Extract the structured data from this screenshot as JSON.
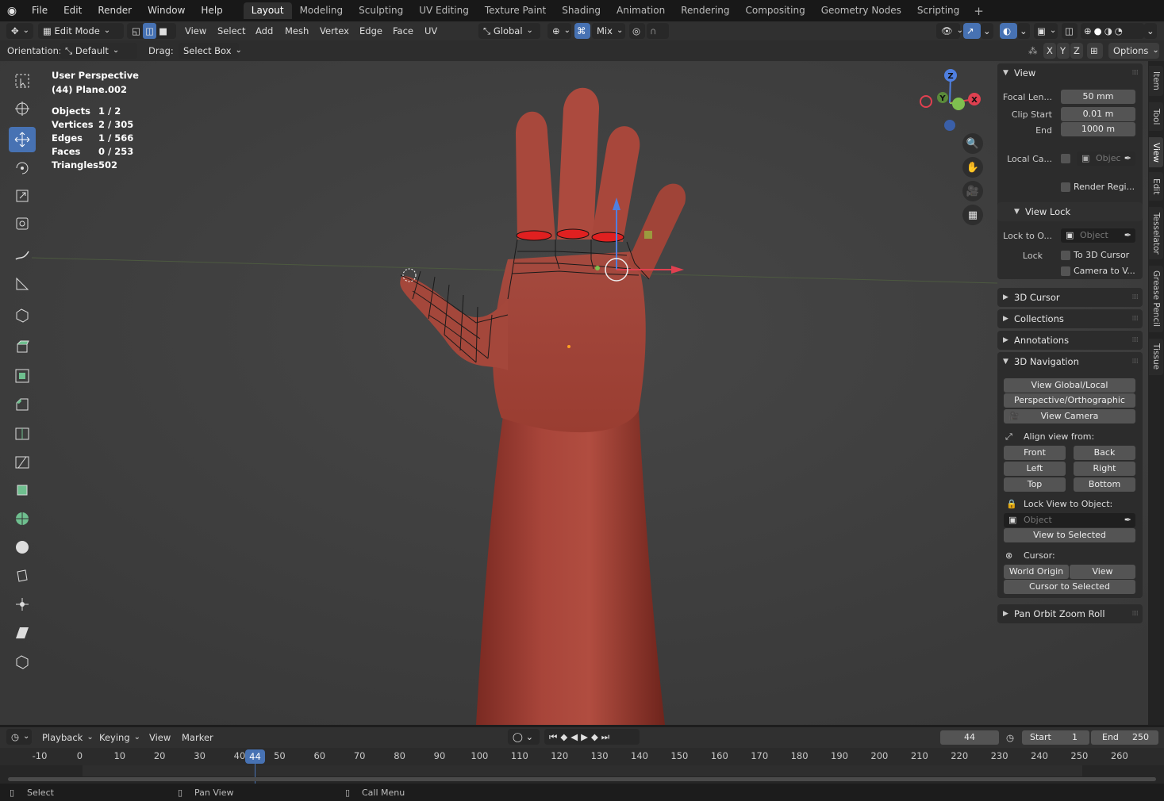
{
  "menu": {
    "items": [
      "File",
      "Edit",
      "Render",
      "Window",
      "Help"
    ],
    "workspaces": [
      "Layout",
      "Modeling",
      "Sculpting",
      "UV Editing",
      "Texture Paint",
      "Shading",
      "Animation",
      "Rendering",
      "Compositing",
      "Geometry Nodes",
      "Scripting"
    ],
    "active_workspace": "Layout"
  },
  "header": {
    "mode": "Edit Mode",
    "menus": [
      "View",
      "Select",
      "Add",
      "Mesh",
      "Vertex",
      "Edge",
      "Face",
      "UV"
    ],
    "transform_orientation": "Global",
    "snap_mode": "Mix",
    "orientation_label": "Orientation:",
    "orientation_value": "Default",
    "drag_label": "Drag:",
    "drag_value": "Select Box",
    "axis_x": "X",
    "axis_y": "Y",
    "axis_z": "Z",
    "options": "Options"
  },
  "overlay": {
    "perspective": "User Perspective",
    "object": "(44) Plane.002",
    "stats": [
      {
        "key": "Objects",
        "value": "1 / 2"
      },
      {
        "key": "Vertices",
        "value": "2 / 305"
      },
      {
        "key": "Edges",
        "value": "1 / 566"
      },
      {
        "key": "Faces",
        "value": "0 / 253"
      },
      {
        "key": "Triangles",
        "value": "502"
      }
    ]
  },
  "gizmo": {
    "x": "X",
    "y": "Y",
    "z": "Z"
  },
  "sidebar_tabs": [
    "Item",
    "Tool",
    "View",
    "Edit",
    "Tesselator",
    "Grease Pencil",
    "Tissue"
  ],
  "active_sidebar_tab": "View",
  "panel": {
    "view": {
      "title": "View",
      "focal_label": "Focal Len...",
      "focal_value": "50 mm",
      "clip_start_label": "Clip Start",
      "clip_start_value": "0.01 m",
      "clip_end_label": "End",
      "clip_end_value": "1000 m",
      "local_camera_label": "Local Ca...",
      "local_camera_placeholder": "Objec",
      "render_region": "Render Regi..."
    },
    "view_lock": {
      "title": "View Lock",
      "lock_to_object_label": "Lock to O...",
      "lock_to_object_placeholder": "Object",
      "lock_label": "Lock",
      "to_3d_cursor": "To 3D Cursor",
      "camera_to_view": "Camera to V..."
    },
    "collapsed": [
      "3D Cursor",
      "Collections",
      "Annotations"
    ],
    "navigation": {
      "title": "3D Navigation",
      "view_global_local": "View Global/Local",
      "persp_ortho": "Perspective/Orthographic",
      "view_camera": "View Camera",
      "align_label": "Align view from:",
      "front": "Front",
      "back": "Back",
      "left": "Left",
      "right": "Right",
      "top": "Top",
      "bottom": "Bottom",
      "lock_view_label": "Lock View to Object:",
      "lock_view_placeholder": "Object",
      "view_to_selected": "View to Selected",
      "cursor_label": "Cursor:",
      "world_origin": "World Origin",
      "view": "View",
      "cursor_to_selected": "Cursor to Selected"
    },
    "pan_orbit": "Pan Orbit Zoom Roll"
  },
  "timeline": {
    "menus": [
      "Playback",
      "Keying",
      "View",
      "Marker"
    ],
    "current_frame": "44",
    "start_label": "Start",
    "start_value": "1",
    "end_label": "End",
    "end_value": "250",
    "ticks": [
      "-10",
      "0",
      "10",
      "20",
      "30",
      "40",
      "50",
      "60",
      "70",
      "80",
      "90",
      "100",
      "110",
      "120",
      "130",
      "140",
      "150",
      "160",
      "170",
      "180",
      "190",
      "200",
      "210",
      "220",
      "230",
      "240",
      "250",
      "260"
    ]
  },
  "statusbar": {
    "select": "Select",
    "pan": "Pan View",
    "call_menu": "Call Menu"
  }
}
